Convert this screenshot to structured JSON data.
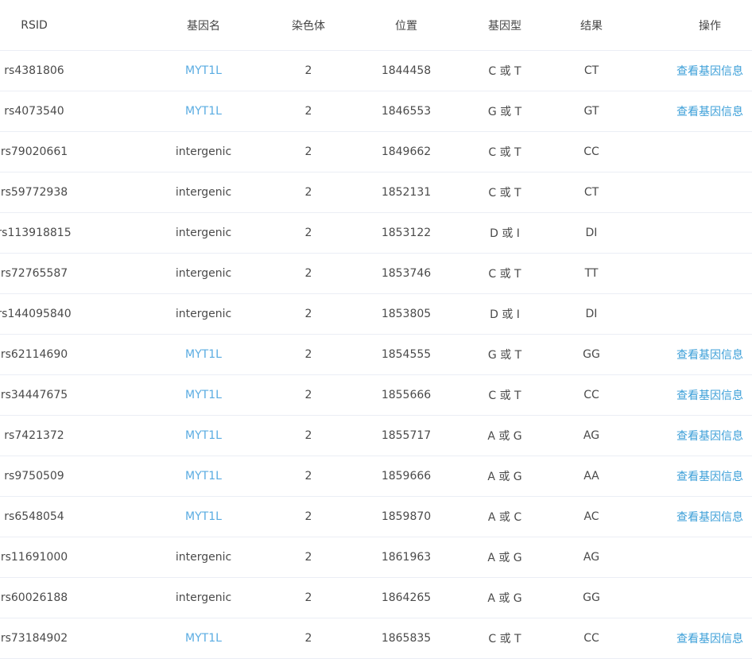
{
  "columns": {
    "rsid": "RSID",
    "gene": "基因名",
    "chromosome": "染色体",
    "position": "位置",
    "genotype": "基因型",
    "result": "结果",
    "action": "操作"
  },
  "action_label": "查看基因信息",
  "colors": {
    "link": "#5aace2",
    "border": "#ebeef5",
    "text": "#4a4a4a"
  },
  "rows": [
    {
      "rsid": "rs4381806",
      "gene": "MYT1L",
      "gene_link": true,
      "chromosome": "2",
      "position": "1844458",
      "genotype": "C 或 T",
      "result": "CT",
      "action": "查看基因信息"
    },
    {
      "rsid": "rs4073540",
      "gene": "MYT1L",
      "gene_link": true,
      "chromosome": "2",
      "position": "1846553",
      "genotype": "G 或 T",
      "result": "GT",
      "action": "查看基因信息"
    },
    {
      "rsid": "rs79020661",
      "gene": "intergenic",
      "gene_link": false,
      "chromosome": "2",
      "position": "1849662",
      "genotype": "C 或 T",
      "result": "CC",
      "action": ""
    },
    {
      "rsid": "rs59772938",
      "gene": "intergenic",
      "gene_link": false,
      "chromosome": "2",
      "position": "1852131",
      "genotype": "C 或 T",
      "result": "CT",
      "action": ""
    },
    {
      "rsid": "rs113918815",
      "gene": "intergenic",
      "gene_link": false,
      "chromosome": "2",
      "position": "1853122",
      "genotype": "D 或 I",
      "result": "DI",
      "action": ""
    },
    {
      "rsid": "rs72765587",
      "gene": "intergenic",
      "gene_link": false,
      "chromosome": "2",
      "position": "1853746",
      "genotype": "C 或 T",
      "result": "TT",
      "action": ""
    },
    {
      "rsid": "rs144095840",
      "gene": "intergenic",
      "gene_link": false,
      "chromosome": "2",
      "position": "1853805",
      "genotype": "D 或 I",
      "result": "DI",
      "action": ""
    },
    {
      "rsid": "rs62114690",
      "gene": "MYT1L",
      "gene_link": true,
      "chromosome": "2",
      "position": "1854555",
      "genotype": "G 或 T",
      "result": "GG",
      "action": "查看基因信息"
    },
    {
      "rsid": "rs34447675",
      "gene": "MYT1L",
      "gene_link": true,
      "chromosome": "2",
      "position": "1855666",
      "genotype": "C 或 T",
      "result": "CC",
      "action": "查看基因信息"
    },
    {
      "rsid": "rs7421372",
      "gene": "MYT1L",
      "gene_link": true,
      "chromosome": "2",
      "position": "1855717",
      "genotype": "A 或 G",
      "result": "AG",
      "action": "查看基因信息"
    },
    {
      "rsid": "rs9750509",
      "gene": "MYT1L",
      "gene_link": true,
      "chromosome": "2",
      "position": "1859666",
      "genotype": "A 或 G",
      "result": "AA",
      "action": "查看基因信息"
    },
    {
      "rsid": "rs6548054",
      "gene": "MYT1L",
      "gene_link": true,
      "chromosome": "2",
      "position": "1859870",
      "genotype": "A 或 C",
      "result": "AC",
      "action": "查看基因信息"
    },
    {
      "rsid": "rs11691000",
      "gene": "intergenic",
      "gene_link": false,
      "chromosome": "2",
      "position": "1861963",
      "genotype": "A 或 G",
      "result": "AG",
      "action": ""
    },
    {
      "rsid": "rs60026188",
      "gene": "intergenic",
      "gene_link": false,
      "chromosome": "2",
      "position": "1864265",
      "genotype": "A 或 G",
      "result": "GG",
      "action": ""
    },
    {
      "rsid": "rs73184902",
      "gene": "MYT1L",
      "gene_link": true,
      "chromosome": "2",
      "position": "1865835",
      "genotype": "C 或 T",
      "result": "CC",
      "action": "查看基因信息"
    }
  ]
}
